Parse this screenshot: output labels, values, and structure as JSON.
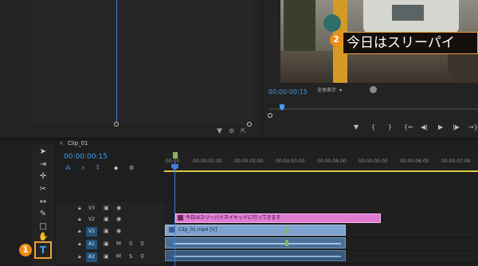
{
  "source_monitor": {},
  "program_monitor": {
    "caption_text": "今日はスリーパイ",
    "badge_number": "2",
    "timecode": "00:00:00:15",
    "fit_label": "全体表示",
    "transport": [
      "{",
      "}",
      "{←",
      "◀|",
      "▶",
      "|▶",
      "→}",
      "↹"
    ]
  },
  "timeline": {
    "tab_title": "Clip_01",
    "timecode": "00:00:00:15",
    "ruler_labels": [
      ":00:00",
      "00:00:01:00",
      "00:00:02:00",
      "00:00:03:00",
      "00:00:04:00",
      "00:00:05:00",
      "00:00:06:00",
      "00:00:07:00"
    ],
    "tracks": [
      {
        "name": "V3",
        "active": false,
        "m": "",
        "s": ""
      },
      {
        "name": "V2",
        "active": false,
        "m": "",
        "s": ""
      },
      {
        "name": "V1",
        "active": true,
        "m": "",
        "s": ""
      },
      {
        "name": "A1",
        "active": true,
        "m": "M",
        "s": "S"
      },
      {
        "name": "A2",
        "active": true,
        "m": "M",
        "s": "S"
      }
    ],
    "caption_clip_label": "今日はスリーパイネイキッドに行ってきます",
    "video_clip_label": "Clip_01.mp4 [V]",
    "type_tool_badge": "1",
    "type_tool_glyph": "T"
  }
}
